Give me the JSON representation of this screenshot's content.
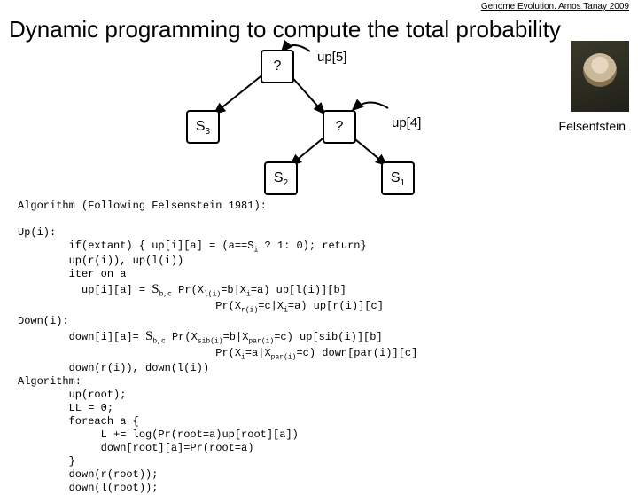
{
  "header_note": "Genome Evolution. Amos Tanay 2009",
  "title": "Dynamic programming to compute the total probability",
  "person_label": "Felsentstein",
  "diagram": {
    "top_q": "?",
    "up5": "up[5]",
    "s3": "S",
    "s3_sub": "3",
    "mid_q": "?",
    "up4": "up[4]",
    "s2": "S",
    "s2_sub": "2",
    "s1": "S",
    "s1_sub": "1"
  },
  "code": {
    "l1": "Algorithm (Following Felsenstein 1981):",
    "l2": "Up(i):",
    "l3": "        if(extant) { up[i][a] = (a==S",
    "l3s": "i",
    "l3b": " ? 1: 0); return}",
    "l4": "        up(r(i)), up(l(i))",
    "l5": "        iter on a",
    "l6a": "          up[i][a] = ",
    "l6sig": "S",
    "l6sub": "b,c",
    "l6b": " Pr(X",
    "l6s1": "l(i)",
    "l6c": "=b|X",
    "l6s2": "i",
    "l6d": "=a) up[l(i)][b]",
    "l7a": "                               Pr(X",
    "l7s1": "r(i)",
    "l7b": "=c|X",
    "l7s2": "i",
    "l7c": "=a) up[r(i)][c]",
    "l8": "Down(i):",
    "l9a": "        down[i][a]= ",
    "l9sig": "S",
    "l9sub": "b,c",
    "l9b": " Pr(X",
    "l9s1": "sib(i)",
    "l9c": "=b|X",
    "l9s2": "par(i)",
    "l9d": "=c) up[sib(i)][b]",
    "l10a": "                               Pr(X",
    "l10s1": "i",
    "l10b": "=a|X",
    "l10s2": "par(i)",
    "l10c": "=c) down[par(i)][c]",
    "l11": "        down(r(i)), down(l(i))",
    "l12": "Algorithm:",
    "l13": "        up(root);",
    "l14": "        LL = 0;",
    "l15": "        foreach a {",
    "l16": "             L += log(Pr(root=a)up[root][a])",
    "l17": "             down[root][a]=Pr(root=a)",
    "l18": "        }",
    "l19": "        down(r(root));",
    "l20": "        down(l(root));"
  }
}
